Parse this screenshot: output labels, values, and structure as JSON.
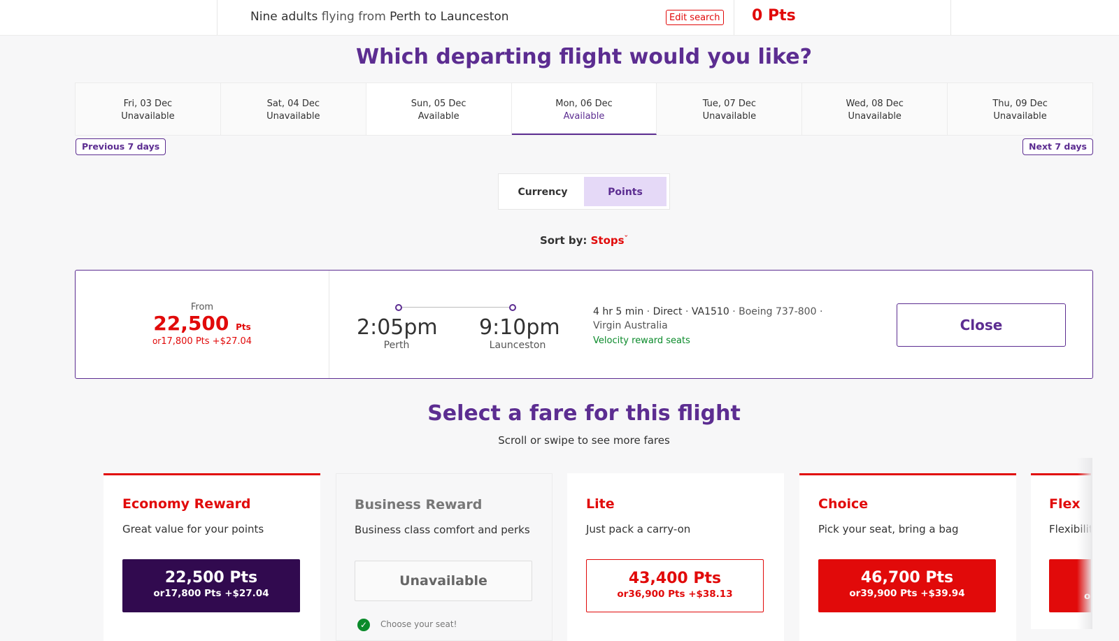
{
  "header": {
    "summary": {
      "count": "Nine adults",
      "flying": "flying",
      "from_word": "from",
      "origin": "Perth",
      "to_word": "to",
      "destination": "Launceston"
    },
    "edit_search": "Edit search",
    "points_total": "0 Pts"
  },
  "page_title": "Which departing flight would you like?",
  "dates": [
    {
      "day": "Fri, 03 Dec",
      "status": "Unavailable"
    },
    {
      "day": "Sat, 04 Dec",
      "status": "Unavailable"
    },
    {
      "day": "Sun, 05 Dec",
      "status": "Available"
    },
    {
      "day": "Mon, 06 Dec",
      "status": "Available",
      "selected": true
    },
    {
      "day": "Tue, 07 Dec",
      "status": "Unavailable"
    },
    {
      "day": "Wed, 08 Dec",
      "status": "Unavailable"
    },
    {
      "day": "Thu, 09 Dec",
      "status": "Unavailable"
    }
  ],
  "prev_days": "Previous 7 days",
  "next_days": "Next 7 days",
  "toggle": {
    "currency": "Currency",
    "points": "Points",
    "active": "points"
  },
  "sort": {
    "label": "Sort by:",
    "value": "Stops",
    "chevron": "ˇ"
  },
  "flight": {
    "from_label": "From",
    "from_points": "22,500",
    "pts_unit": "Pts",
    "or_word": "or",
    "alt_price": "17,800 Pts +$27.04",
    "depart_time": "2:05pm",
    "depart_city": "Perth",
    "arrive_time": "9:10pm",
    "arrive_city": "Launceston",
    "duration": "4 hr 5 min",
    "sep": "·",
    "stops": "Direct",
    "flight_no": "VA1510",
    "aircraft": "Boeing 737-800",
    "carrier": "Virgin Australia",
    "velocity": "Velocity reward seats",
    "close": "Close"
  },
  "fares_title": "Select a fare for this flight",
  "fares_sub": "Scroll or swipe to see more fares",
  "fares": {
    "economy": {
      "name": "Economy Reward",
      "desc": "Great value for your points",
      "price": "22,500 Pts",
      "or": "or",
      "alt": "17,800 Pts +$27.04"
    },
    "business": {
      "name": "Business Reward",
      "desc": "Business class comfort and perks",
      "price": "Unavailable",
      "feature": "Choose your seat!"
    },
    "lite": {
      "name": "Lite",
      "desc": "Just pack a carry-on",
      "price": "43,400 Pts",
      "or": "or",
      "alt": "36,900 Pts +$38.13"
    },
    "choice": {
      "name": "Choice",
      "desc": "Pick your seat, bring a bag",
      "price": "46,700 Pts",
      "or": "or",
      "alt": "39,900 Pts +$39.94"
    },
    "flex": {
      "name": "Flex",
      "desc": "Flexibilit",
      "or": "o"
    }
  },
  "colors": {
    "brand_purple": "#5c2d91",
    "brand_red": "#e10a0a",
    "dark_purple": "#310a4f",
    "success_green": "#0a8a2a"
  }
}
